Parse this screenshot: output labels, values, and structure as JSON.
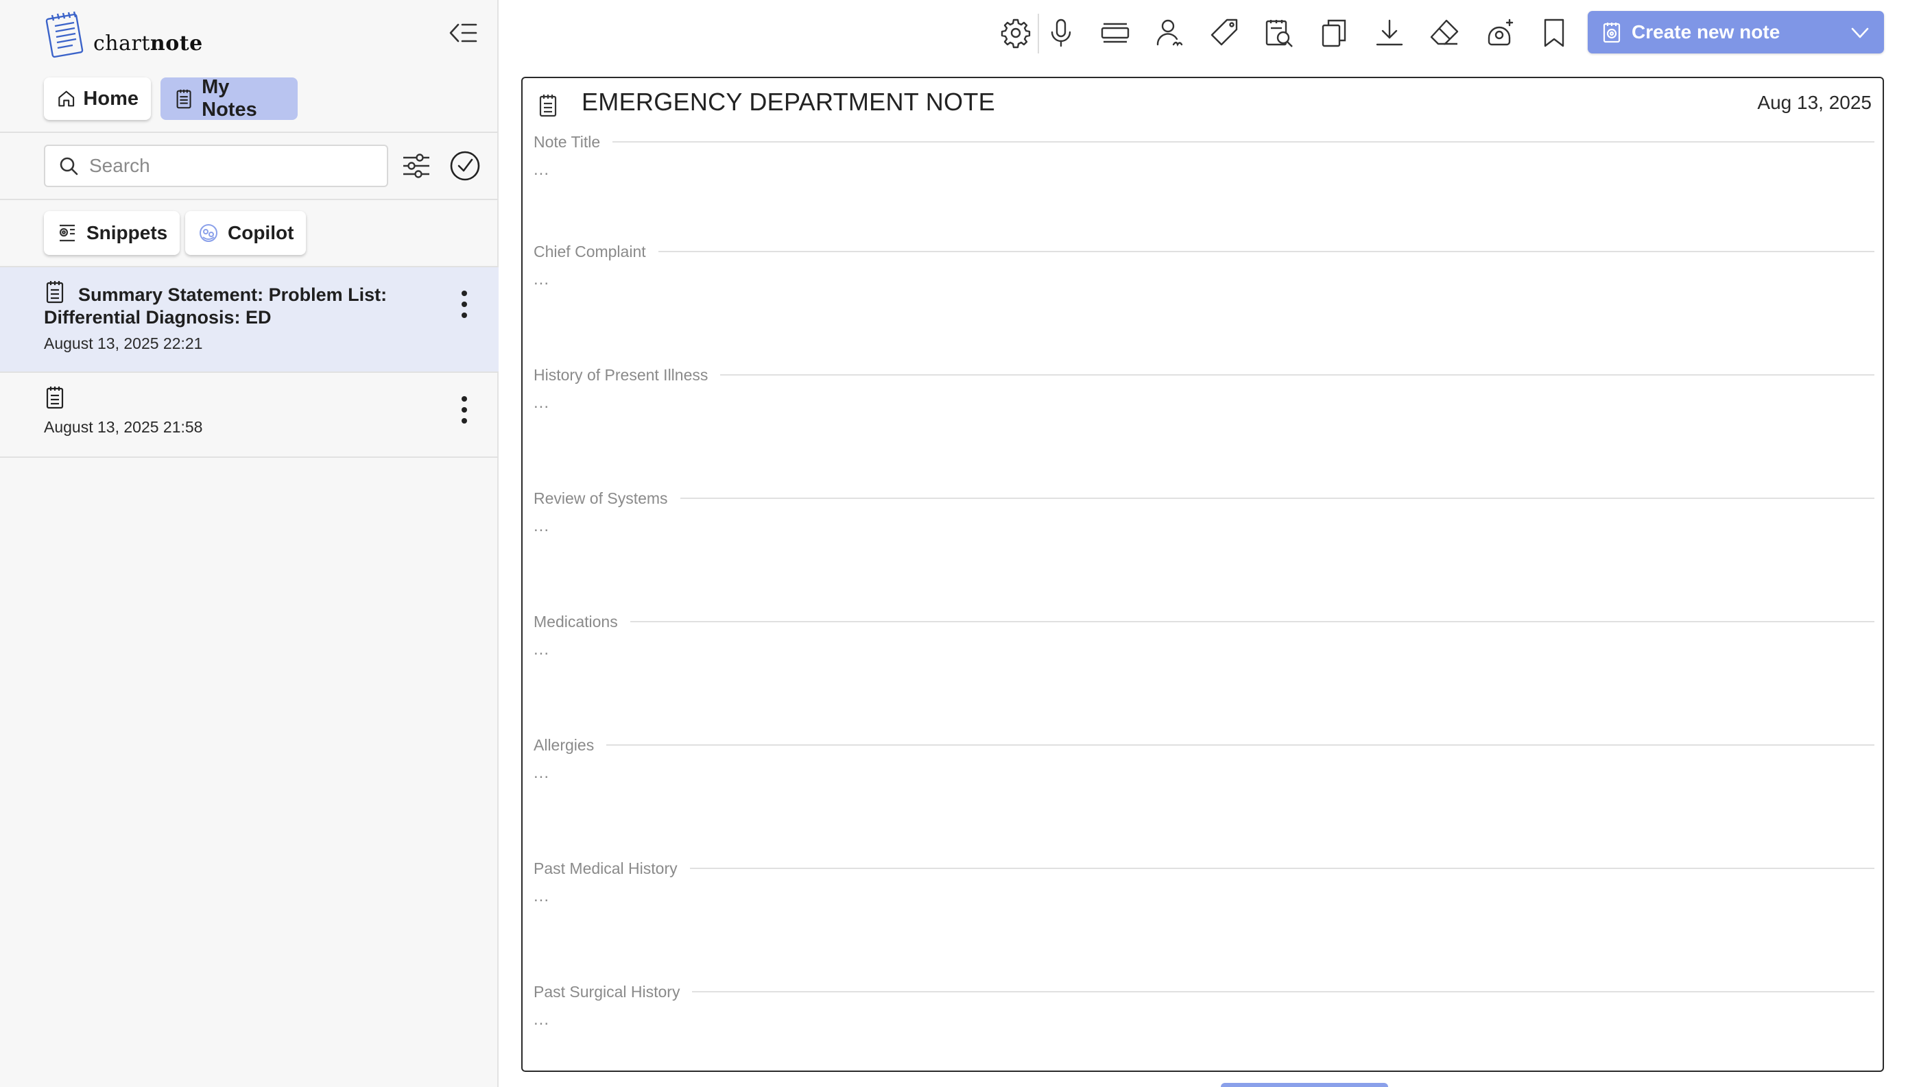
{
  "app": {
    "logo_text_light": "chart",
    "logo_text_bold": "note"
  },
  "sidebar": {
    "nav": {
      "home_label": "Home",
      "my_notes_label": "My Notes"
    },
    "search": {
      "placeholder": "Search",
      "value": ""
    },
    "chips": {
      "snippets_label": "Snippets",
      "copilot_label": "Copilot"
    },
    "notes": [
      {
        "title": "Summary Statement: Problem List: Differential Diagnosis: ED",
        "date": "August 13, 2025 22:21",
        "selected": true
      },
      {
        "title": "",
        "date": "August 13, 2025 21:58",
        "selected": false
      }
    ]
  },
  "toolbar": {
    "icons": [
      "gear-icon",
      "microphone-icon",
      "layout-icon",
      "user-signature-icon",
      "tag-icon",
      "document-search-icon",
      "copy-icon",
      "download-icon",
      "eraser-icon",
      "ai-sparkle-icon",
      "bookmark-icon"
    ],
    "create_label": "Create new note"
  },
  "note": {
    "heading": "EMERGENCY DEPARTMENT NOTE",
    "date": "Aug 13, 2025",
    "sections": [
      {
        "label": "Note Title",
        "value": "..."
      },
      {
        "label": "Chief Complaint",
        "value": "..."
      },
      {
        "label": "History of Present Illness",
        "value": "..."
      },
      {
        "label": "Review of Systems",
        "value": "..."
      },
      {
        "label": "Medications",
        "value": "..."
      },
      {
        "label": "Allergies",
        "value": "..."
      },
      {
        "label": "Past Medical History",
        "value": "..."
      },
      {
        "label": "Past Surgical History",
        "value": "..."
      }
    ]
  },
  "colors": {
    "accent": "#7f96e6",
    "nav_selected": "#b9c4f0",
    "note_selected": "#e6eaf7"
  }
}
